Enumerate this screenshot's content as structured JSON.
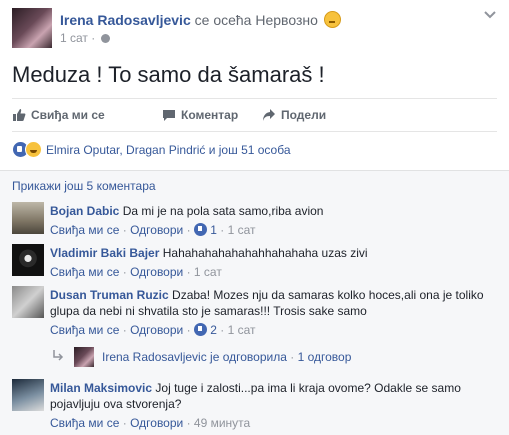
{
  "post": {
    "author": "Irena Radosavljevic",
    "feeling": "се осећа Нервозно",
    "time": "1 сат",
    "text": "Meduza ! To samo da šamaraš !"
  },
  "actions": {
    "like": "Свиђа ми се",
    "comment": "Коментар",
    "share": "Подели"
  },
  "reactions": {
    "summary": "Elmira Oputar, Dragan Pindrić и још 51 особа"
  },
  "comments_section": {
    "view_more": "Прикажи још 5 коментара",
    "comments": [
      {
        "name": "Bojan Dabic",
        "text": "Da mi je na pola sata samo,riba avion",
        "like": "Свиђа ми се",
        "reply": "Одговори",
        "likes": "1",
        "time": "1 сат"
      },
      {
        "name": "Vladimir Baki Bajer",
        "text": "Hahahahahahahahhahahaha uzas zivi",
        "like": "Свиђа ми се",
        "reply": "Одговори",
        "time": "1 сат"
      },
      {
        "name": "Dusan Truman Ruzic",
        "text": "Dzaba! Mozes nju da samaras kolko hoces,ali ona je toliko glupa da nebi ni shvatila sto je samaras!!! Trosis sake samo",
        "like": "Свиђа ми се",
        "reply": "Одговори",
        "likes": "2",
        "time": "1 сат"
      },
      {
        "name": "Milan Maksimovic",
        "text": "Joj tuge i zalosti...pa ima li kraja ovome? Odakle se samo pojavljuju ova stvorenja?",
        "like": "Свиђа ми се",
        "reply": "Одговори",
        "time": "49 минута"
      }
    ],
    "reply_summary": {
      "text": "Irena Radosavljevic је одговорила",
      "count": "1 одговор"
    }
  },
  "icons": {
    "feeling": "nervous-emoji-icon",
    "privacy": "globe-icon",
    "menu": "chevron-down-icon",
    "like": "thumbs-up-icon",
    "comment": "speech-bubble-icon",
    "share": "share-arrow-icon",
    "reaction_like": "like-reaction-icon",
    "reaction_haha": "haha-reaction-icon",
    "reply": "reply-arrow-icon"
  },
  "colors": {
    "link": "#365899",
    "muted": "#90949c",
    "like_blue": "#4267b2",
    "text": "#1d2129"
  }
}
